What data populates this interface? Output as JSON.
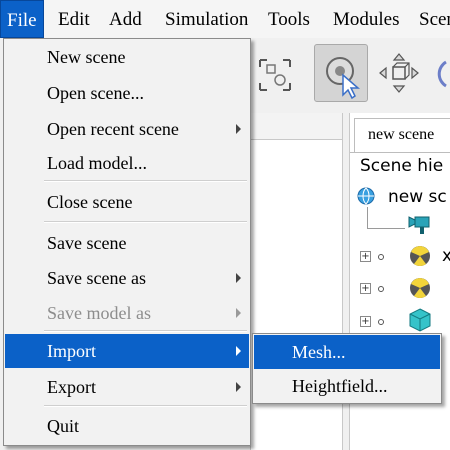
{
  "menubar": {
    "items": [
      "File",
      "Edit",
      "Add",
      "Simulation",
      "Tools",
      "Modules",
      "Scen"
    ],
    "active_index": 0
  },
  "toolbar": {
    "buttons": [
      {
        "icon": "fit-view-icon",
        "pressed": false
      },
      {
        "icon": "select-cursor-icon",
        "pressed": true
      },
      {
        "icon": "move-object-icon",
        "pressed": false
      },
      {
        "icon": "rotate-object-icon",
        "pressed": false
      }
    ]
  },
  "file_menu": {
    "items": [
      {
        "label": "New scene",
        "submenu": false,
        "disabled": false
      },
      {
        "label": "Open scene...",
        "submenu": false,
        "disabled": false
      },
      {
        "label": "Open recent scene",
        "submenu": true,
        "disabled": false
      },
      {
        "label": "Load model...",
        "submenu": false,
        "disabled": false
      },
      {
        "label": "Close scene",
        "submenu": false,
        "disabled": false
      },
      {
        "label": "Save scene",
        "submenu": false,
        "disabled": false
      },
      {
        "label": "Save scene as",
        "submenu": true,
        "disabled": false
      },
      {
        "label": "Save model as",
        "submenu": true,
        "disabled": true
      },
      {
        "label": "Import",
        "submenu": true,
        "disabled": false,
        "highlighted": true
      },
      {
        "label": "Export",
        "submenu": true,
        "disabled": false
      },
      {
        "label": "Quit",
        "submenu": false,
        "disabled": false
      }
    ]
  },
  "import_submenu": {
    "items": [
      {
        "label": "Mesh...",
        "highlighted": true
      },
      {
        "label": "Heightfield...",
        "highlighted": false
      }
    ]
  },
  "scene_panel": {
    "tab_label": "new scene",
    "hierarchy_label": "Scene hie",
    "root_label": "new sc",
    "trailing_char": "x"
  },
  "colors": {
    "highlight": "#0b61c8",
    "menu_bg": "#f2f2f2",
    "disabled_text": "#8d8d8d"
  }
}
